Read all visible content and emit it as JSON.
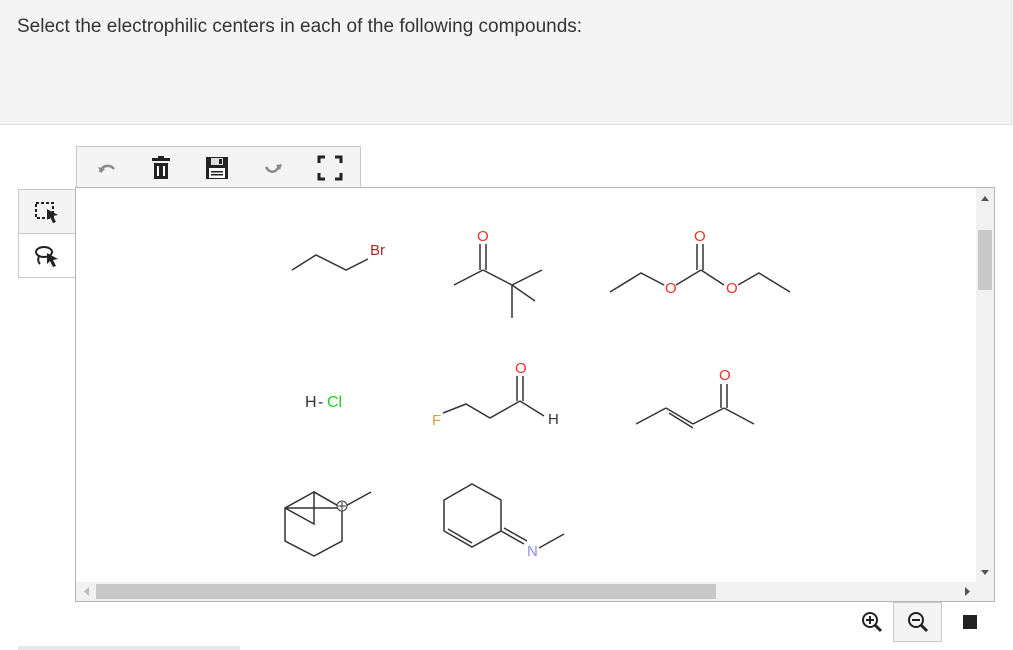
{
  "question": {
    "text": "Select the electrophilic centers in each of the following compounds:"
  },
  "toolbar": {
    "items": [
      {
        "name": "undo",
        "icon": "undo-icon"
      },
      {
        "name": "delete",
        "icon": "trash-icon"
      },
      {
        "name": "save",
        "icon": "save-icon"
      },
      {
        "name": "redo",
        "icon": "redo-icon"
      },
      {
        "name": "fullscreen",
        "icon": "fullscreen-icon"
      }
    ]
  },
  "side_tools": [
    {
      "name": "select",
      "icon": "select-cursor-icon",
      "selected": true
    },
    {
      "name": "lasso",
      "icon": "lasso-icon",
      "selected": false
    }
  ],
  "molecules": {
    "m1": {
      "label": "Br"
    },
    "m2": {
      "label": "O"
    },
    "m3": {
      "o_top": "O",
      "o_left": "O",
      "o_right": "O"
    },
    "m4": {
      "h": "H",
      "bond": "-",
      "cl": "Cl"
    },
    "m5": {
      "f": "F",
      "o": "O",
      "h": "H"
    },
    "m6": {
      "o": "O"
    },
    "m8": {
      "n": "N"
    }
  },
  "colors": {
    "oxygen": "#e8322c",
    "bromine": "#a52a2a",
    "chlorine": "#1fcf1f",
    "fluorine": "#d3a43a",
    "nitrogen": "#8a8cf0",
    "bond": "#333333"
  },
  "bottom_tools": [
    {
      "name": "zoom-in",
      "icon": "zoom-in-icon"
    },
    {
      "name": "zoom-out",
      "icon": "zoom-out-icon",
      "active": true
    },
    {
      "name": "stop",
      "icon": "stop-icon"
    }
  ]
}
